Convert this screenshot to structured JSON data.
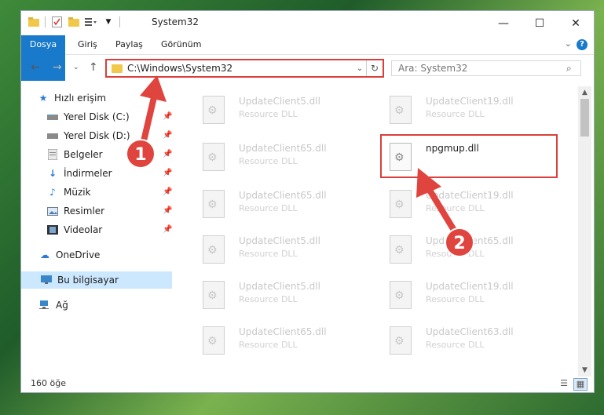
{
  "window": {
    "title": "System32",
    "controls": {
      "minimize": "—",
      "maximize": "☐",
      "close": "✕"
    }
  },
  "ribbon": {
    "tabs": [
      "Dosya",
      "Giriş",
      "Paylaş",
      "Görünüm"
    ],
    "help": "?"
  },
  "address": {
    "path": "C:\\Windows\\System32",
    "search_placeholder": "Ara: System32"
  },
  "sidebar": {
    "quick_access": "Hızlı erişim",
    "items": [
      {
        "label": "Yerel Disk (C:)",
        "icon": "drive-icon"
      },
      {
        "label": "Yerel Disk (D:)",
        "icon": "drive-icon"
      },
      {
        "label": "Belgeler",
        "icon": "documents-icon"
      },
      {
        "label": "İndirmeler",
        "icon": "downloads-icon"
      },
      {
        "label": "Müzik",
        "icon": "music-icon"
      },
      {
        "label": "Resimler",
        "icon": "pictures-icon"
      },
      {
        "label": "Videolar",
        "icon": "videos-icon"
      }
    ],
    "onedrive": "OneDrive",
    "this_pc": "Bu bilgisayar",
    "network": "Ağ"
  },
  "files": [
    {
      "name": "UpdateClient5.dll",
      "type": "Resource DLL"
    },
    {
      "name": "UpdateClient19.dll",
      "type": "Resource DLL"
    },
    {
      "name": "UpdateClient65.dll",
      "type": "Resource DLL"
    },
    {
      "name": "npgmup.dll",
      "type": ""
    },
    {
      "name": "UpdateClient65.dll",
      "type": "Resource DLL"
    },
    {
      "name": "UpdateClient19.dll",
      "type": "Resource DLL"
    },
    {
      "name": "UpdateClient5.dll",
      "type": "Resource DLL"
    },
    {
      "name": "UpdateClient65.dll",
      "type": "Resource DLL"
    },
    {
      "name": "UpdateClient5.dll",
      "type": "Resource DLL"
    },
    {
      "name": "UpdateClient19.dll",
      "type": "Resource DLL"
    },
    {
      "name": "UpdateClient65.dll",
      "type": "Resource DLL"
    },
    {
      "name": "UpdateClient63.dll",
      "type": "Resource DLL"
    }
  ],
  "status": {
    "count": "160 öğe"
  },
  "annotations": {
    "badge1": "1",
    "badge2": "2"
  },
  "colors": {
    "accent": "#1979ca",
    "highlight": "#d9403b"
  }
}
